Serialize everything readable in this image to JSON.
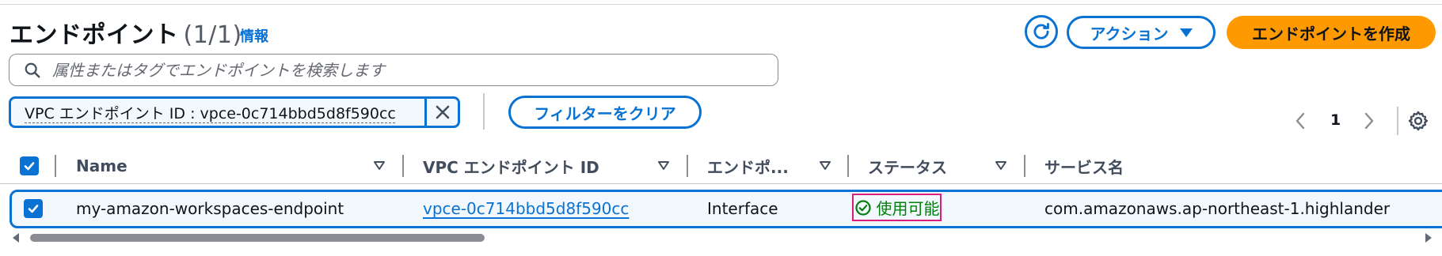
{
  "header": {
    "title": "エンドポイント",
    "count": "(1/1)",
    "info_link": "情報"
  },
  "toolbar": {
    "refresh_icon": "refresh-icon",
    "actions_label": "アクション",
    "create_label": "エンドポイントを作成"
  },
  "search": {
    "placeholder": "属性またはタグでエンドポイントを検索します",
    "icon": "search-icon"
  },
  "filter": {
    "token_label": "VPC エンドポイント ID : vpce-0c714bbd5d8f590cc",
    "clear_label": "フィルターをクリア"
  },
  "pagination": {
    "current_page": "1"
  },
  "table": {
    "columns": [
      {
        "label": "Name"
      },
      {
        "label": "VPC エンドポイント ID"
      },
      {
        "label": "エンドポ..."
      },
      {
        "label": "ステータス"
      },
      {
        "label": "サービス名"
      }
    ],
    "rows": [
      {
        "name": "my-amazon-workspaces-endpoint",
        "endpoint_id": "vpce-0c714bbd5d8f590cc",
        "type": "Interface",
        "status": "使用可能",
        "service_name": "com.amazonaws.ap-northeast-1.highlander",
        "selected": true
      }
    ]
  },
  "colors": {
    "accent": "#0972d3",
    "primary_button": "#ff9900",
    "status_success": "#037f0c",
    "highlight_box": "#d91f7a"
  }
}
